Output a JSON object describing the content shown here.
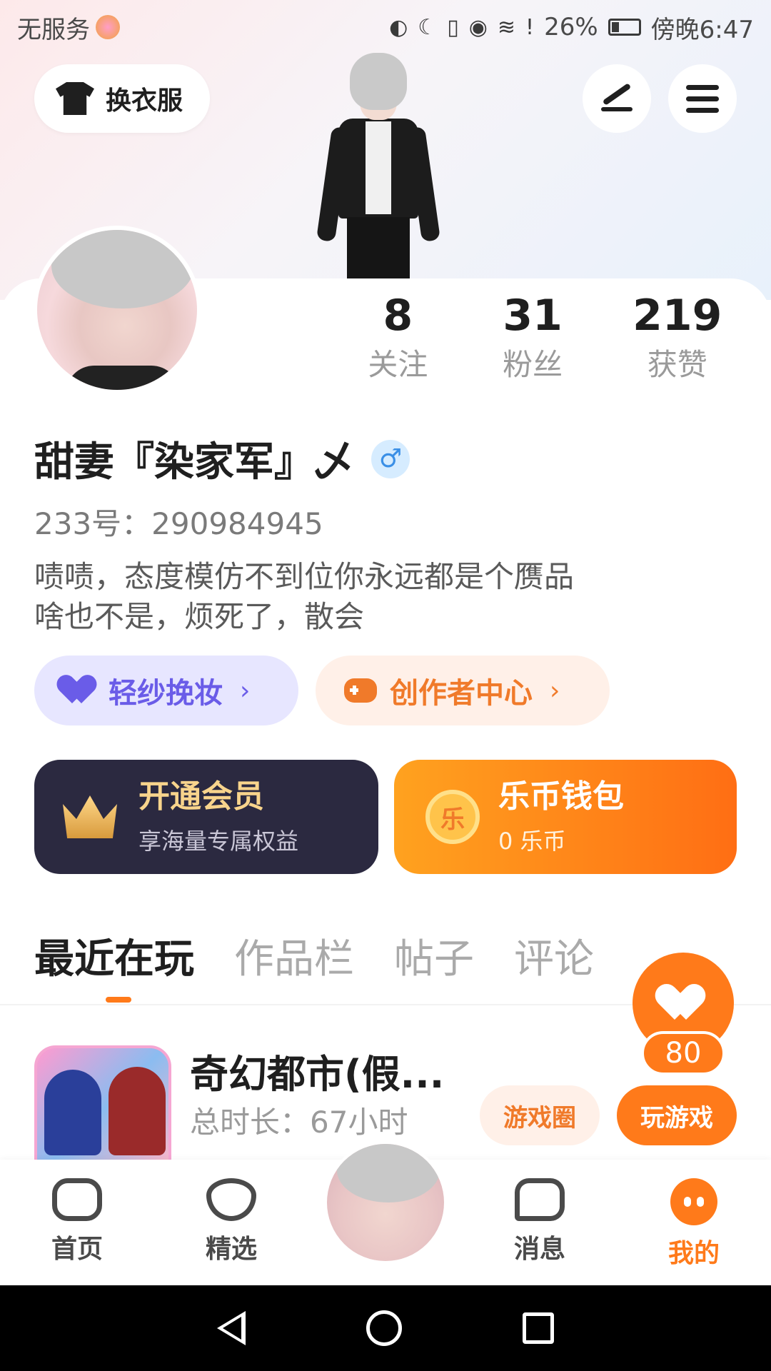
{
  "status_bar": {
    "carrier": "无服务",
    "battery": "26%",
    "time": "傍晚6:47"
  },
  "header": {
    "outfit_label": "换衣服"
  },
  "profile": {
    "stats": [
      {
        "value": "8",
        "label": "关注"
      },
      {
        "value": "31",
        "label": "粉丝"
      },
      {
        "value": "219",
        "label": "获赞"
      }
    ],
    "name": "甜妻『染家军』乄",
    "gender_symbol": "♂",
    "uid": "233号：290984945",
    "bio_line1": "啧啧，态度模仿不到位你永远都是个赝品",
    "bio_line2": "啥也不是，烦死了，散会"
  },
  "chips": {
    "makeup": "轻纱挽妆",
    "creator": "创作者中心",
    "arrow": "›"
  },
  "cards": {
    "vip_title": "开通会员",
    "vip_sub": "享海量专属权益",
    "wallet_title": "乐币钱包",
    "wallet_sub": "0 乐币",
    "coin_glyph": "乐"
  },
  "tabs": [
    "最近在玩",
    "作品栏",
    "帖子",
    "评论"
  ],
  "recent_game": {
    "title": "奇幻都市(假...",
    "playtime": "总时长：67小时",
    "circle_label": "游戏圈",
    "play_label": "玩游戏"
  },
  "like_fab": {
    "count": "80"
  },
  "bottom_nav": {
    "home": "首页",
    "featured": "精选",
    "messages": "消息",
    "mine": "我的"
  },
  "colors": {
    "accent": "#ff7a1a",
    "vip_bg": "#2b2940",
    "makeup_chip": "#6a5ce8"
  }
}
